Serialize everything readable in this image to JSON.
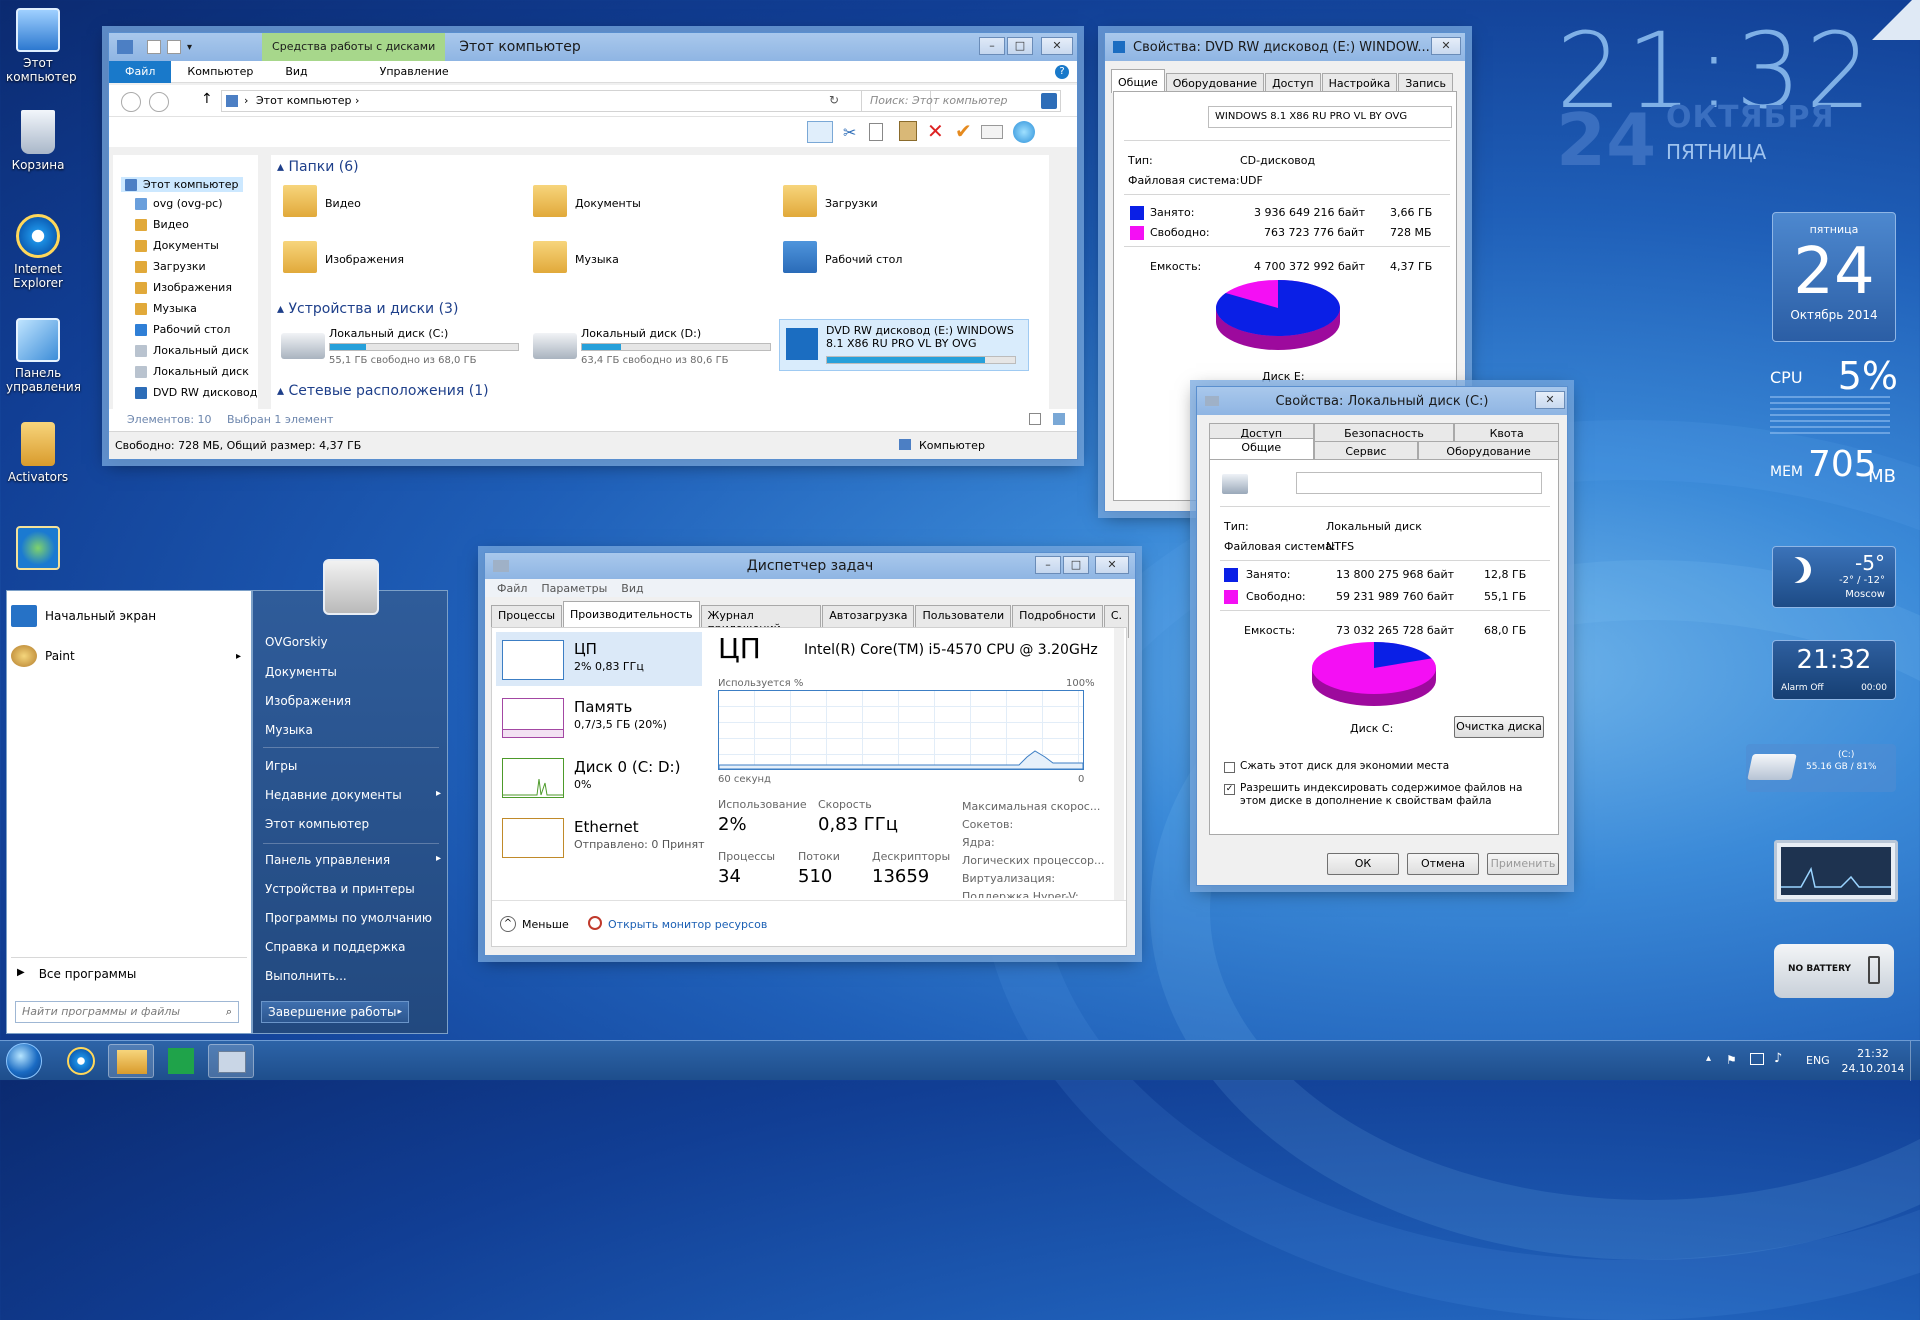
{
  "desktop": {
    "icons": [
      {
        "label": "Этот\nкомпьютер",
        "icon": "computer-icon"
      },
      {
        "label": "Корзина",
        "icon": "recycle-bin-icon"
      },
      {
        "label": "Internet\nExplorer",
        "icon": "ie-icon"
      },
      {
        "label": "Панель\nуправления",
        "icon": "control-panel-icon"
      },
      {
        "label": "Activators",
        "icon": "folder-icon"
      }
    ]
  },
  "clock_widget": {
    "time": "21:32",
    "day": "24",
    "month": "ОКТЯБРЯ",
    "weekday": "ПЯТНИЦА"
  },
  "calendar_gadget": {
    "weekday": "пятница",
    "day": "24",
    "month_year": "Октябрь 2014"
  },
  "cpu_gadget": {
    "label": "CPU",
    "value": "5%",
    "mem_label": "MEM",
    "mem_value": "705",
    "mem_unit": "MB"
  },
  "weather_gadget": {
    "temp": "-5°",
    "range": "-2° / -12°",
    "city": "Moscow"
  },
  "alarm_gadget": {
    "time": "21:32",
    "alarm": "Alarm Off",
    "alarm_time": "00:00"
  },
  "drive_gadget": {
    "label": "(C:)",
    "detail": "55.16 GB / 81%"
  },
  "battery_gadget": {
    "label": "NO BATTERY"
  },
  "explorer": {
    "tool_tab": "Средства работы с дисками",
    "title": "Этот компьютер",
    "ribbon_tabs": [
      "Файл",
      "Компьютер",
      "Вид",
      "Управление"
    ],
    "address": "Этот компьютер",
    "search_placeholder": "Поиск: Этот компьютер",
    "tree": [
      "Этот компьютер",
      "ovg (ovg-pc)",
      "Видео",
      "Документы",
      "Загрузки",
      "Изображения",
      "Музыка",
      "Рабочий стол",
      "Локальный диск",
      "Локальный диск",
      "DVD RW дисковод"
    ],
    "folders_header": "Папки (6)",
    "folders": [
      "Видео",
      "Документы",
      "Загрузки",
      "Изображения",
      "Музыка",
      "Рабочий стол"
    ],
    "devices_header": "Устройства и диски (3)",
    "drives": [
      {
        "name": "Локальный диск (C:)",
        "detail": "55,1 ГБ свободно из 68,0 ГБ",
        "used": 0.19
      },
      {
        "name": "Локальный диск (D:)",
        "detail": "63,4 ГБ свободно из 80,6 ГБ",
        "used": 0.21
      },
      {
        "name": "DVD RW дисковод (E:) WINDOWS 8.1 X86 RU PRO VL BY OVG",
        "detail": "",
        "used": 0.84
      }
    ],
    "network_header": "Сетевые расположения (1)",
    "status_items": "Элементов: 10",
    "status_selected": "Выбран 1 элемент",
    "footer_left": "Свободно: 728 МБ, Общий размер: 4,37 ГБ",
    "footer_right": "Компьютер"
  },
  "dvd_props": {
    "title": "Свойства: DVD RW дисковод (E:) WINDOW...",
    "tabs": [
      "Общие",
      "Оборудование",
      "Доступ",
      "Настройка",
      "Запись"
    ],
    "label": "WINDOWS 8.1 X86 RU PRO VL BY OVG",
    "type_label": "Тип:",
    "type": "CD-дисковод",
    "fs_label": "Файловая система:",
    "fs": "UDF",
    "used_label": "Занято:",
    "used_bytes": "3 936 649 216 байт",
    "used_h": "3,66 ГБ",
    "free_label": "Свободно:",
    "free_bytes": "763 723 776 байт",
    "free_h": "728 МБ",
    "cap_label": "Емкость:",
    "cap_bytes": "4 700 372 992 байт",
    "cap_h": "4,37 ГБ",
    "disk": "Диск E:",
    "used_fraction": 0.84
  },
  "c_props": {
    "title": "Свойства: Локальный диск (C:)",
    "tabs_top": [
      "Доступ",
      "Безопасность",
      "Квота"
    ],
    "tabs_bottom": [
      "Общие",
      "Сервис",
      "Оборудование"
    ],
    "type_label": "Тип:",
    "type": "Локальный диск",
    "fs_label": "Файловая система:",
    "fs": "NTFS",
    "used_label": "Занято:",
    "used_bytes": "13 800 275 968 байт",
    "used_h": "12,8 ГБ",
    "free_label": "Свободно:",
    "free_bytes": "59 231 989 760 байт",
    "free_h": "55,1 ГБ",
    "cap_label": "Емкость:",
    "cap_bytes": "73 032 265 728 байт",
    "cap_h": "68,0 ГБ",
    "disk": "Диск C:",
    "cleanup": "Очистка диска",
    "compress": "Сжать этот диск для экономии места",
    "index": "Разрешить индексировать содержимое файлов на этом диске в дополнение к свойствам файла",
    "ok": "ОК",
    "cancel": "Отмена",
    "apply": "Применить",
    "used_fraction": 0.19
  },
  "task_manager": {
    "title": "Диспетчер задач",
    "menu": [
      "Файл",
      "Параметры",
      "Вид"
    ],
    "tabs": [
      "Процессы",
      "Производительность",
      "Журнал приложений",
      "Автозагрузка",
      "Пользователи",
      "Подробности",
      "С."
    ],
    "side": [
      {
        "name": "ЦП",
        "detail": "2% 0,83 ГГц"
      },
      {
        "name": "Память",
        "detail": "0,7/3,5 ГБ (20%)"
      },
      {
        "name": "Диск 0 (C: D:)",
        "detail": "0%"
      },
      {
        "name": "Ethernet",
        "detail": "Отправлено: 0 Принят"
      }
    ],
    "cpu_title": "ЦП",
    "cpu_model": "Intel(R) Core(TM) i5-4570 CPU @ 3.20GHz",
    "usage_label": "Используется %",
    "usage_max": "100%",
    "graph_left": "60 секунд",
    "graph_right": "0",
    "util_label": "Использование",
    "util": "2%",
    "speed_label": "Скорость",
    "speed": "0,83 ГГц",
    "proc_label": "Процессы",
    "proc": "34",
    "threads_label": "Потоки",
    "threads": "510",
    "handles_label": "Дескрипторы",
    "handles": "13659",
    "info": [
      "Максимальная скорос...",
      "Сокетов:",
      "Ядра:",
      "Логических процессор...",
      "Виртуализация:",
      "Поддержка Hyper-V:"
    ],
    "less": "Меньше",
    "open_monitor": "Открыть монитор ресурсов"
  },
  "start_menu": {
    "left_items": [
      "Начальный экран",
      "Paint"
    ],
    "all_programs": "Все программы",
    "search_placeholder": "Найти программы и файлы",
    "right_items": [
      "OVGorskiy",
      "Документы",
      "Изображения",
      "Музыка",
      "Игры",
      "Недавние документы",
      "Этот компьютер",
      "Панель управления",
      "Устройства и принтеры",
      "Программы по умолчанию",
      "Справка и поддержка",
      "Выполнить..."
    ],
    "shutdown": "Завершение работы"
  },
  "taskbar": {
    "lang": "ENG",
    "time": "21:32",
    "date": "24.10.2014"
  }
}
